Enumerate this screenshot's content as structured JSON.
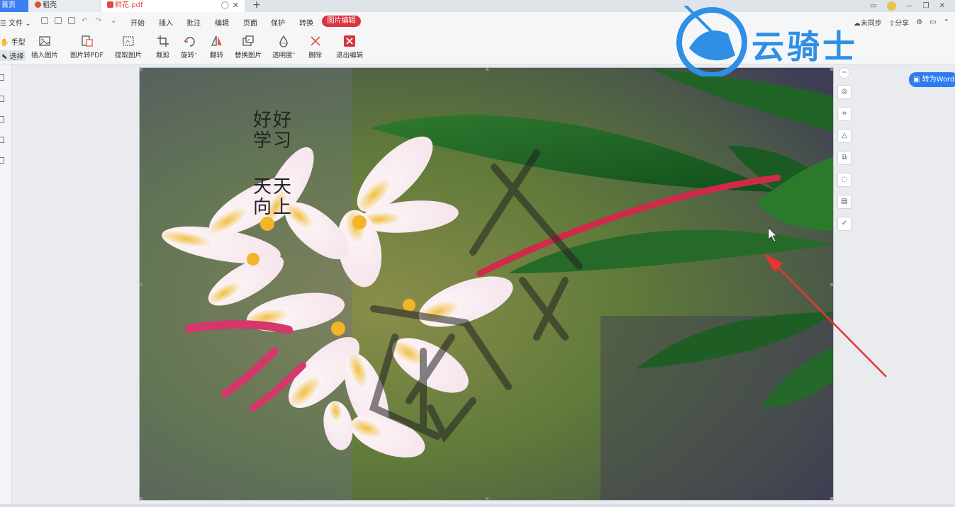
{
  "tabs": {
    "home": "首页",
    "daoke": "稻壳",
    "pdf": "鲜花.pdf",
    "add": "+"
  },
  "menu": {
    "file": "文件",
    "items": [
      "开始",
      "插入",
      "批注",
      "编辑",
      "页面",
      "保护",
      "转换"
    ],
    "active": "图片编辑",
    "unsync": "未同步",
    "share": "分享"
  },
  "mode": {
    "hand": "手型",
    "select": "选择"
  },
  "ribbon": {
    "buttons": [
      "插入图片",
      "图片转PDF",
      "提取图片",
      "裁剪",
      "旋转",
      "翻转",
      "替换图片",
      "透明度",
      "删除",
      "退出编辑"
    ]
  },
  "to_word": "转为Word",
  "image_text": {
    "line1": "好好",
    "line2": "学习",
    "line3": "天天",
    "line4": "向上"
  },
  "watermark": "云骑士",
  "colors": {
    "accent": "#2f7cf2",
    "active_tab": "#d9363e",
    "arrow": "#e8362f"
  }
}
